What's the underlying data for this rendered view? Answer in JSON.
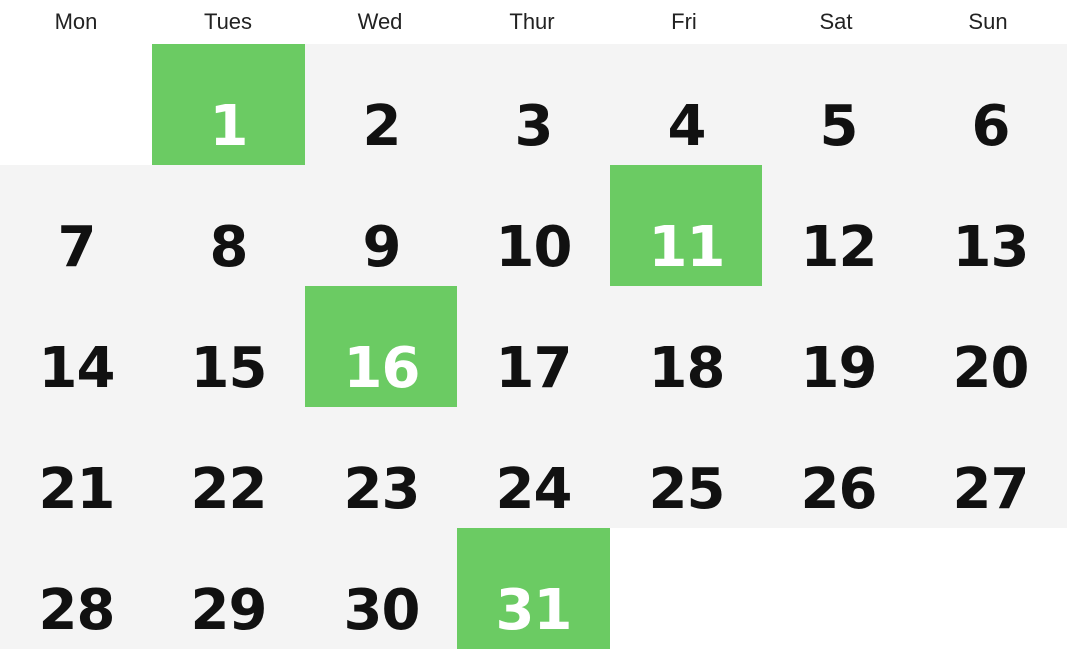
{
  "calendar": {
    "weekdays": [
      "Mon",
      "Tues",
      "Wed",
      "Thur",
      "Fri",
      "Sat",
      "Sun"
    ],
    "first_day_column": 1,
    "days_in_month": 31,
    "highlighted_days": [
      1,
      11,
      16,
      31
    ],
    "colors": {
      "highlight": "#6bcb63",
      "cell_background": "#f4f4f4",
      "page_background": "#ffffff",
      "text": "#111111",
      "highlight_text": "#ffffff"
    }
  }
}
